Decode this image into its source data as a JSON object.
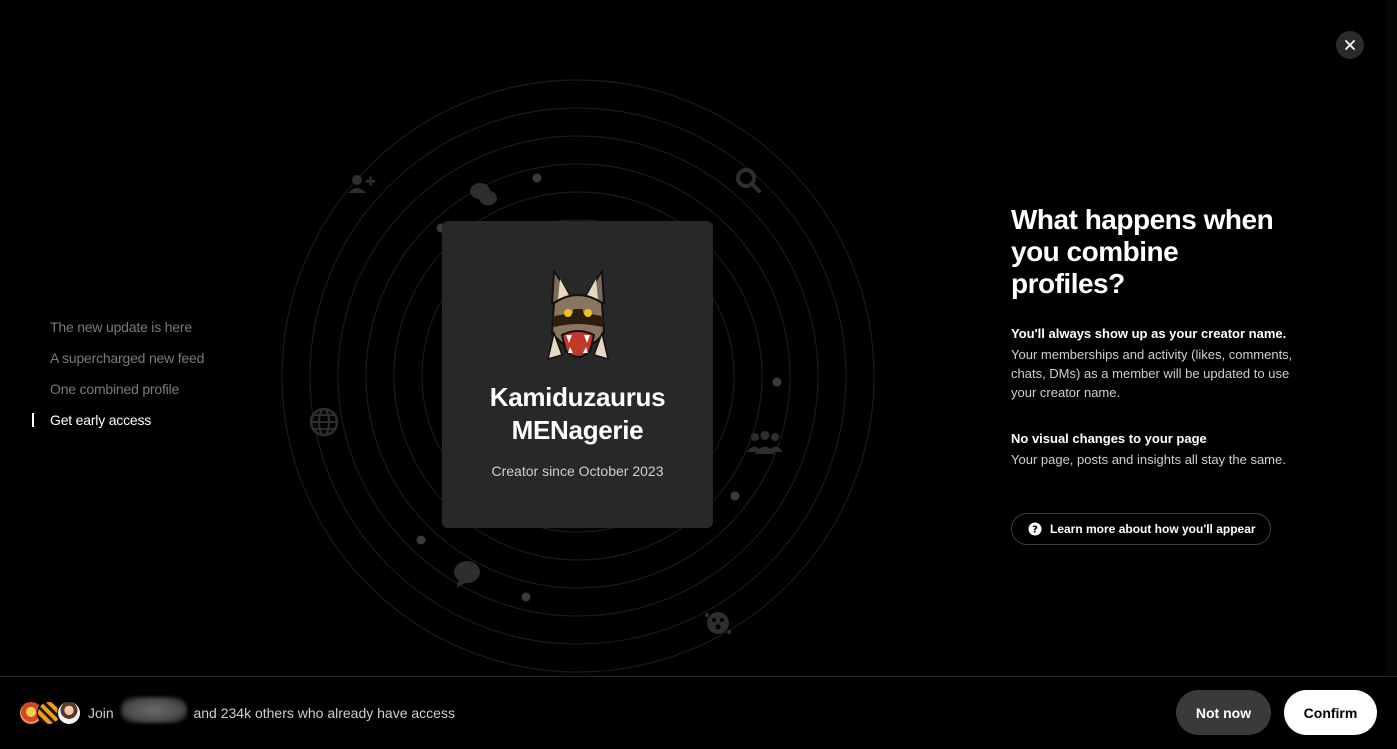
{
  "close": {
    "icon": "close-icon"
  },
  "steps": [
    {
      "label": "The new update is here",
      "active": false
    },
    {
      "label": "A supercharged new feed",
      "active": false
    },
    {
      "label": "One combined profile",
      "active": false
    },
    {
      "label": "Get early access",
      "active": true
    }
  ],
  "card": {
    "name": "Kamiduzaurus\nMENagerie",
    "since": "Creator since October 2023"
  },
  "info": {
    "title": "What happens when you combine profiles?",
    "sections": [
      {
        "heading": "You'll always show up as your creator name.",
        "body": "Your memberships and activity (likes, comments, chats, DMs) as a member will be updated to use your creator name."
      },
      {
        "heading": "No visual changes to your page",
        "body": "Your page, posts and insights all stay the same."
      }
    ],
    "learn_more_label": "Learn more about how you'll appear"
  },
  "bottom": {
    "join_prefix": "Join",
    "join_suffix": "and 234k others who already have access",
    "not_now_label": "Not now",
    "confirm_label": "Confirm"
  },
  "colors": {
    "background": "#000000",
    "card": "#282828",
    "secondary_button": "#3a3a3a",
    "primary_button": "#ffffff",
    "muted_text": "#7a7a7a"
  }
}
